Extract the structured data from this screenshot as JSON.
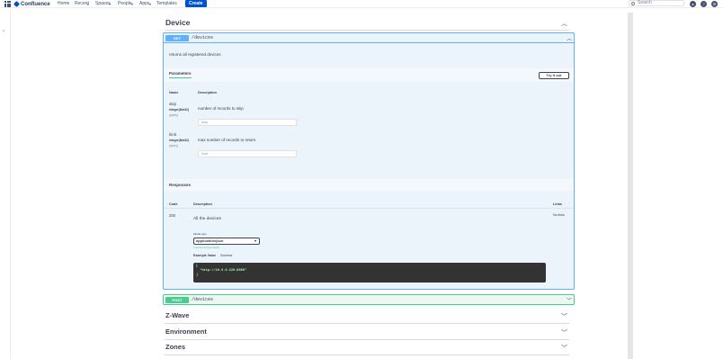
{
  "topnav": {
    "brand": "Confluence",
    "links": [
      "Home",
      "Recent",
      "Spaces",
      "People",
      "Apps",
      "Templates"
    ],
    "create_label": "Create",
    "search_placeholder": "Search"
  },
  "swagger": {
    "device_section": {
      "title": "Device",
      "get_operation": {
        "method": "GET",
        "path": "/devices",
        "description": "returns all registered devices",
        "parameters_label": "Parameters",
        "try_it_out_label": "Try it out",
        "col_name": "Name",
        "col_description": "Description",
        "params": [
          {
            "name": "skip",
            "type": "integer($int32)",
            "in": "(query)",
            "description": "number of records to skip",
            "placeholder": "skip"
          },
          {
            "name": "limit",
            "type": "integer($int32)",
            "in": "(query)",
            "description": "max number of records to return",
            "placeholder": "limit"
          }
        ],
        "responses_label": "Responses",
        "col_code": "Code",
        "col_links": "Links",
        "response": {
          "code": "200",
          "description": "All the devices",
          "media_type_label": "Media type",
          "media_type_value": "application/json",
          "controls_note": "Controls Accept header.",
          "example_value_tab": "Example Value",
          "schema_tab": "Schema",
          "example_lines": [
            "[",
            "  \"http://10.0.0.220:8080\"",
            "]"
          ],
          "links": "No links"
        }
      },
      "post_operation": {
        "method": "POST",
        "path": "/devices"
      }
    },
    "other_sections": [
      "Z-Wave",
      "Environment",
      "Zones"
    ]
  },
  "colors": {
    "get": "#61affe",
    "post": "#49cc90",
    "create": "#0052cc"
  }
}
